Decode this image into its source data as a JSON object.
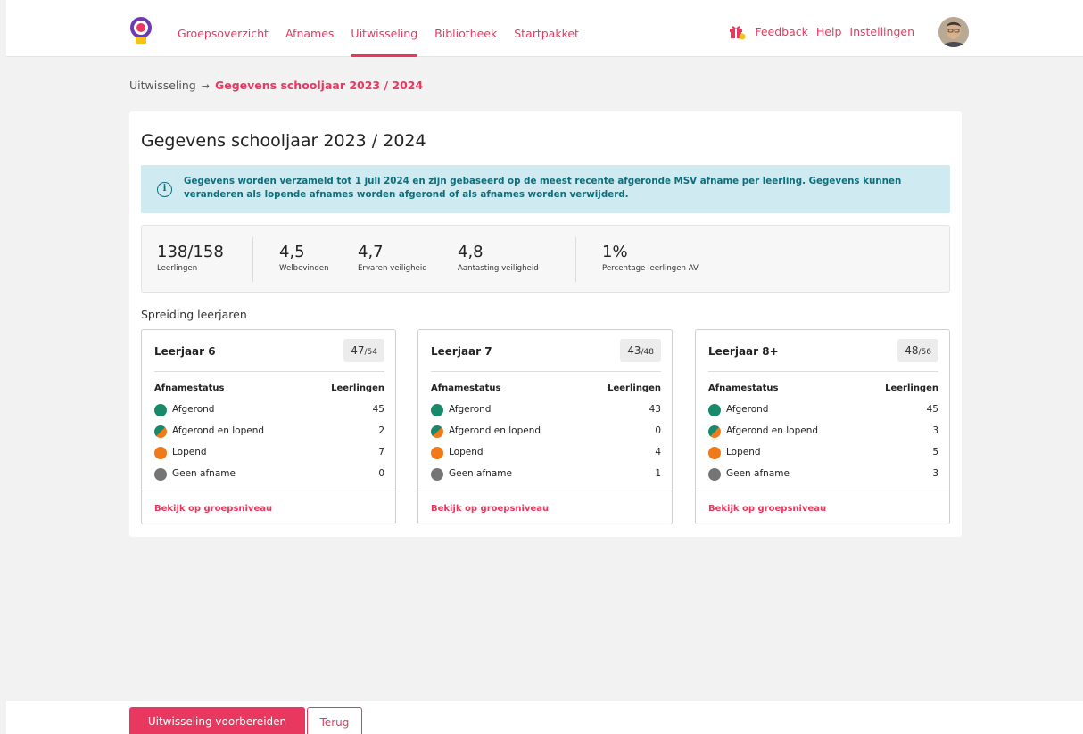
{
  "nav": {
    "items": [
      {
        "label": "Groepsoverzicht",
        "active": false
      },
      {
        "label": "Afnames",
        "active": false
      },
      {
        "label": "Uitwisseling",
        "active": true
      },
      {
        "label": "Bibliotheek",
        "active": false
      },
      {
        "label": "Startpakket",
        "active": false
      }
    ],
    "right": {
      "feedback": "Feedback",
      "help": "Help",
      "settings": "Instellingen"
    }
  },
  "breadcrumb": {
    "parent": "Uitwisseling",
    "separator": "→",
    "current": "Gegevens schooljaar 2023 / 2024"
  },
  "page": {
    "title": "Gegevens schooljaar 2023 / 2024",
    "info": "Gegevens worden verzameld tot 1 juli 2024 en zijn gebaseerd op de meest recente afgeronde MSV afname per leerling. Gegevens kunnen veranderen als lopende afnames worden afgerond of als afnames worden verwijderd."
  },
  "stats": [
    {
      "value": "138/158",
      "label": "Leerlingen"
    },
    {
      "value": "4,5",
      "label": "Welbevinden"
    },
    {
      "value": "4,7",
      "label": "Ervaren veiligheid"
    },
    {
      "value": "4,8",
      "label": "Aantasting veiligheid"
    },
    {
      "value": "1%",
      "label": "Percentage leerlingen AV"
    }
  ],
  "spreiding": {
    "title": "Spreiding leerjaren",
    "col_status": "Afnamestatus",
    "col_count": "Leerlingen",
    "link": "Bekijk op groepsniveau",
    "cards": [
      {
        "title": "Leerjaar 6",
        "done": "47",
        "total": "/54",
        "rows": [
          {
            "label": "Afgerond",
            "value": "45"
          },
          {
            "label": "Afgerond en lopend",
            "value": "2"
          },
          {
            "label": "Lopend",
            "value": "7"
          },
          {
            "label": "Geen afname",
            "value": "0"
          }
        ]
      },
      {
        "title": "Leerjaar 7",
        "done": "43",
        "total": "/48",
        "rows": [
          {
            "label": "Afgerond",
            "value": "43"
          },
          {
            "label": "Afgerond en lopend",
            "value": "0"
          },
          {
            "label": "Lopend",
            "value": "4"
          },
          {
            "label": "Geen afname",
            "value": "1"
          }
        ]
      },
      {
        "title": "Leerjaar 8+",
        "done": "48",
        "total": "/56",
        "rows": [
          {
            "label": "Afgerond",
            "value": "45"
          },
          {
            "label": "Afgerond en lopend",
            "value": "3"
          },
          {
            "label": "Lopend",
            "value": "5"
          },
          {
            "label": "Geen afname",
            "value": "3"
          }
        ]
      }
    ]
  },
  "colors": {
    "accent": "#e8385f",
    "afgerond": "#168a6b",
    "lopend": "#f07a1a",
    "geen": "#757575",
    "info_bg": "#cfeaf0",
    "info_text": "#0d6f7c"
  },
  "footer": {
    "primary": "Uitwisseling voorbereiden",
    "secondary": "Terug"
  }
}
